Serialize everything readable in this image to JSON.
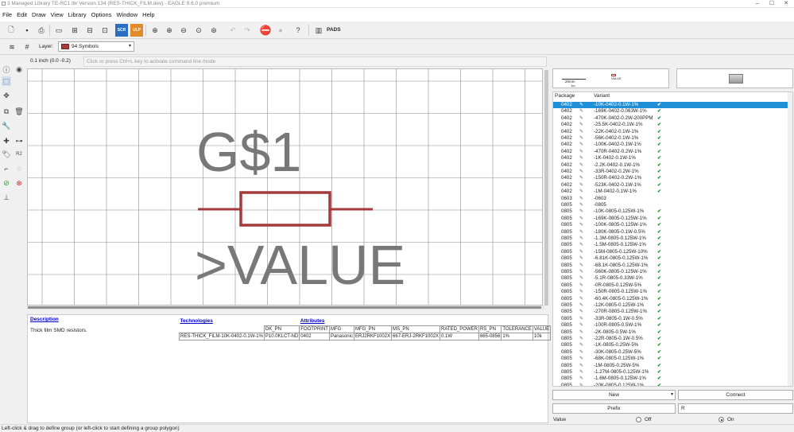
{
  "window": {
    "title": "3 Managed Library TE-RC1.lbr Version 134 (RES-THICK_FILM.dev) - EAGLE 9.6.0 premium",
    "controls": [
      "–",
      "☐",
      "✕"
    ]
  },
  "menu": [
    "File",
    "Edit",
    "Draw",
    "View",
    "Library",
    "Options",
    "Window",
    "Help"
  ],
  "toolbar": {
    "scr_label": "SCR",
    "ulp_label": "ULP",
    "pads_label": "PADS"
  },
  "layer": {
    "label": "Layer:",
    "selected": "94 Symbols",
    "color": "#a33b3b"
  },
  "command": {
    "coordinate": "0.1 inch (0.0 -0.2)",
    "placeholder": "Click or press Ctrl+L key to activate command line mode"
  },
  "canvas": {
    "name_text": "G$1",
    "value_text": ">VALUE",
    "symbol_color": "#a33b3b",
    "text_color": "#787878"
  },
  "description": {
    "heading": "Description",
    "text": "Thick film SMD resistors."
  },
  "technologies": {
    "heading": "Technologies",
    "row": "RES-THICK_FILM-10K-0402-0.1W-1%"
  },
  "attributes": {
    "heading": "Attributes",
    "columns": [
      "DK_PN",
      "FOOTPRINT",
      "MFG",
      "MFG_PN",
      "MS_PN",
      "RATED_POWER",
      "RS_PN",
      "TOLERANCE",
      "VALUE"
    ],
    "values": [
      "P10.0KLCT-ND",
      "0402",
      "Panasonic",
      "ERJ2RKF1002X",
      "667-ERJ-2RKF1002X",
      "0.1W",
      "665-0856",
      "1%",
      "10k"
    ]
  },
  "preview": {
    "scale_label": "20mm",
    "scale_sub": "1m",
    "value_tag": "VALUE"
  },
  "variant_list": {
    "headers": {
      "package": "Package",
      "variant": "Variant"
    },
    "rows": [
      {
        "pkg": "0402",
        "var": "-10K-0402-0.1W-1%",
        "ok": true,
        "sel": true
      },
      {
        "pkg": "0402",
        "var": "-169K-0402-0.063W-1%",
        "ok": true
      },
      {
        "pkg": "0402",
        "var": "-470K-0402-0.2W-200PPM",
        "ok": true
      },
      {
        "pkg": "0402",
        "var": "-25.5K-0402-0.1W-1%",
        "ok": true
      },
      {
        "pkg": "0402",
        "var": "-22K-0402-0.1W-1%",
        "ok": true
      },
      {
        "pkg": "0402",
        "var": "-56K-0402-0.1W-1%",
        "ok": true
      },
      {
        "pkg": "0402",
        "var": "-100K-0402-0.1W-1%",
        "ok": true
      },
      {
        "pkg": "0402",
        "var": "-470R-0402-0.2W-1%",
        "ok": true
      },
      {
        "pkg": "0402",
        "var": "-1K-0402-0.1W-1%",
        "ok": true
      },
      {
        "pkg": "0402",
        "var": "-2.2K-0402-0.1W-1%",
        "ok": true
      },
      {
        "pkg": "0402",
        "var": "-33R-0402-0.2W-1%",
        "ok": true
      },
      {
        "pkg": "0402",
        "var": "-150R-0402-0.2W-1%",
        "ok": true
      },
      {
        "pkg": "0402",
        "var": "-523K-0402-0.1W-1%",
        "ok": true
      },
      {
        "pkg": "0402",
        "var": "-1M-0402-0.1W-1%",
        "ok": true
      },
      {
        "pkg": "0603",
        "var": "-0603",
        "ok": false
      },
      {
        "pkg": "0805",
        "var": "-0805",
        "ok": false
      },
      {
        "pkg": "0805",
        "var": "-10K-0805-0.125W-1%",
        "ok": true
      },
      {
        "pkg": "0805",
        "var": "-169K-0805-0.125W-1%",
        "ok": true
      },
      {
        "pkg": "0805",
        "var": "-100K-0805-0.125W-1%",
        "ok": true
      },
      {
        "pkg": "0805",
        "var": "-180K-0805-0.1W-0.5%",
        "ok": true
      },
      {
        "pkg": "0805",
        "var": "-1.3M-0805-0.125W-1%",
        "ok": true
      },
      {
        "pkg": "0805",
        "var": "-1.5M-0805-0.125W-1%",
        "ok": true
      },
      {
        "pkg": "0805",
        "var": "-15M-0805-0.125W-10%",
        "ok": true
      },
      {
        "pkg": "0805",
        "var": "-6.81K-0805-0.125W-1%",
        "ok": true
      },
      {
        "pkg": "0805",
        "var": "-68.1K-0805-0.125W-1%",
        "ok": true
      },
      {
        "pkg": "0805",
        "var": "-560K-0805-0.125W-1%",
        "ok": true
      },
      {
        "pkg": "0805",
        "var": "-5.1R-0805-0.33W-1%",
        "ok": true
      },
      {
        "pkg": "0805",
        "var": "-0R-0805-0.125W-5%",
        "ok": true
      },
      {
        "pkg": "0805",
        "var": "-150R-0805-0.125W-1%",
        "ok": true
      },
      {
        "pkg": "0805",
        "var": "-60.4K-0805-0.125W-1%",
        "ok": true
      },
      {
        "pkg": "0805",
        "var": "-12K-0805-0.125W-1%",
        "ok": true
      },
      {
        "pkg": "0805",
        "var": "-270R-0805-0.125W-1%",
        "ok": true
      },
      {
        "pkg": "0805",
        "var": "-33R-0805-0.1W-0.5%",
        "ok": true
      },
      {
        "pkg": "0805",
        "var": "-100R-0805-0.5W-1%",
        "ok": true
      },
      {
        "pkg": "0805",
        "var": "-2K-0805-0.5W-1%",
        "ok": true
      },
      {
        "pkg": "0805",
        "var": "-22R-0805-0.1W-0.5%",
        "ok": true
      },
      {
        "pkg": "0805",
        "var": "-1K-0805-0.25W-5%",
        "ok": true
      },
      {
        "pkg": "0805",
        "var": "-30K-0805-0.25W-5%",
        "ok": true
      },
      {
        "pkg": "0805",
        "var": "-68K-0805-0.125W-1%",
        "ok": true
      },
      {
        "pkg": "0805",
        "var": "-1M-0805-0.25W-5%",
        "ok": true
      },
      {
        "pkg": "0805",
        "var": "-1.27M-0805-0.125W-1%",
        "ok": true
      },
      {
        "pkg": "0805",
        "var": "-1.6M-0805-0.125W-1%",
        "ok": true
      },
      {
        "pkg": "0805",
        "var": "-20K-0805-0.125W-1%",
        "ok": true
      }
    ]
  },
  "buttons": {
    "new": "New",
    "connect": "Connect",
    "prefix": "Prefix",
    "prefix_value": "R"
  },
  "value_option": {
    "label": "Value",
    "off": "Off",
    "on": "On",
    "selected": "On"
  },
  "status": "Left-click & drag to define group (or left-click to start defining a group polygon)"
}
